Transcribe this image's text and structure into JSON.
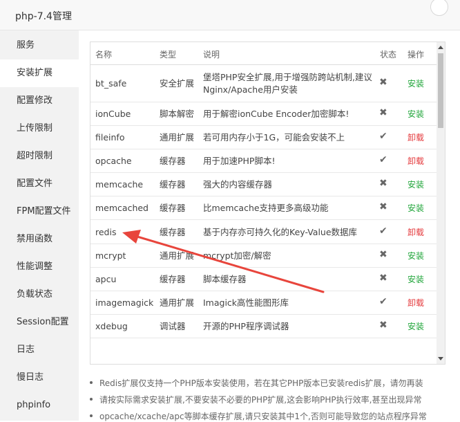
{
  "window": {
    "title": "php-7.4管理"
  },
  "sidebar": {
    "items": [
      {
        "label": "服务",
        "active": false
      },
      {
        "label": "安装扩展",
        "active": true
      },
      {
        "label": "配置修改",
        "active": false
      },
      {
        "label": "上传限制",
        "active": false
      },
      {
        "label": "超时限制",
        "active": false
      },
      {
        "label": "配置文件",
        "active": false
      },
      {
        "label": "FPM配置文件",
        "active": false
      },
      {
        "label": "禁用函数",
        "active": false
      },
      {
        "label": "性能调整",
        "active": false
      },
      {
        "label": "负载状态",
        "active": false
      },
      {
        "label": "Session配置",
        "active": false
      },
      {
        "label": "日志",
        "active": false
      },
      {
        "label": "慢日志",
        "active": false
      },
      {
        "label": "phpinfo",
        "active": false
      }
    ]
  },
  "table": {
    "headers": {
      "name": "名称",
      "type": "类型",
      "desc": "说明",
      "status": "状态",
      "op": "操作"
    },
    "rows": [
      {
        "name": "bt_safe",
        "type": "安全扩展",
        "desc": "堡塔PHP安全扩展,用于增强防跨站机制,建议",
        "desc2": "Nginx/Apache用户安装",
        "status": "✖",
        "op": "安装",
        "op_kind": "install"
      },
      {
        "name": "ionCube",
        "type": "脚本解密",
        "desc": "用于解密ionCube Encoder加密脚本!",
        "status": "✖",
        "op": "安装",
        "op_kind": "install"
      },
      {
        "name": "fileinfo",
        "type": "通用扩展",
        "desc": "若可用内存小于1G，可能会安装不上",
        "status": "✔",
        "op": "卸载",
        "op_kind": "uninstall"
      },
      {
        "name": "opcache",
        "type": "缓存器",
        "desc": "用于加速PHP脚本!",
        "status": "✔",
        "op": "卸载",
        "op_kind": "uninstall"
      },
      {
        "name": "memcache",
        "type": "缓存器",
        "desc": "强大的内容缓存器",
        "status": "✖",
        "op": "安装",
        "op_kind": "install"
      },
      {
        "name": "memcached",
        "type": "缓存器",
        "desc": "比memcache支持更多高级功能",
        "status": "✖",
        "op": "安装",
        "op_kind": "install"
      },
      {
        "name": "redis",
        "type": "缓存器",
        "desc": "基于内存亦可持久化的Key-Value数据库",
        "status": "✔",
        "op": "卸载",
        "op_kind": "uninstall"
      },
      {
        "name": "mcrypt",
        "type": "通用扩展",
        "desc": "mcrypt加密/解密",
        "status": "✖",
        "op": "安装",
        "op_kind": "install"
      },
      {
        "name": "apcu",
        "type": "缓存器",
        "desc": "脚本缓存器",
        "status": "✖",
        "op": "安装",
        "op_kind": "install"
      },
      {
        "name": "imagemagick",
        "type": "通用扩展",
        "desc": "Imagick高性能图形库",
        "status": "✔",
        "op": "卸载",
        "op_kind": "uninstall"
      },
      {
        "name": "xdebug",
        "type": "调试器",
        "desc": "开源的PHP程序调试器",
        "status": "✖",
        "op": "安装",
        "op_kind": "install"
      }
    ]
  },
  "notes": [
    "Redis扩展仅支持一个PHP版本安装使用，若在其它PHP版本已安装redis扩展，请勿再装",
    "请按实际需求安装扩展,不要安装不必要的PHP扩展,这会影响PHP执行效率,甚至出现异常",
    "opcache/xcache/apc等脚本缓存扩展,请只安装其中1个,否则可能导致您的站点程序异常"
  ],
  "colors": {
    "install": "#20a53a",
    "uninstall": "#e4393c",
    "annotation_arrow": "#e8453c"
  }
}
